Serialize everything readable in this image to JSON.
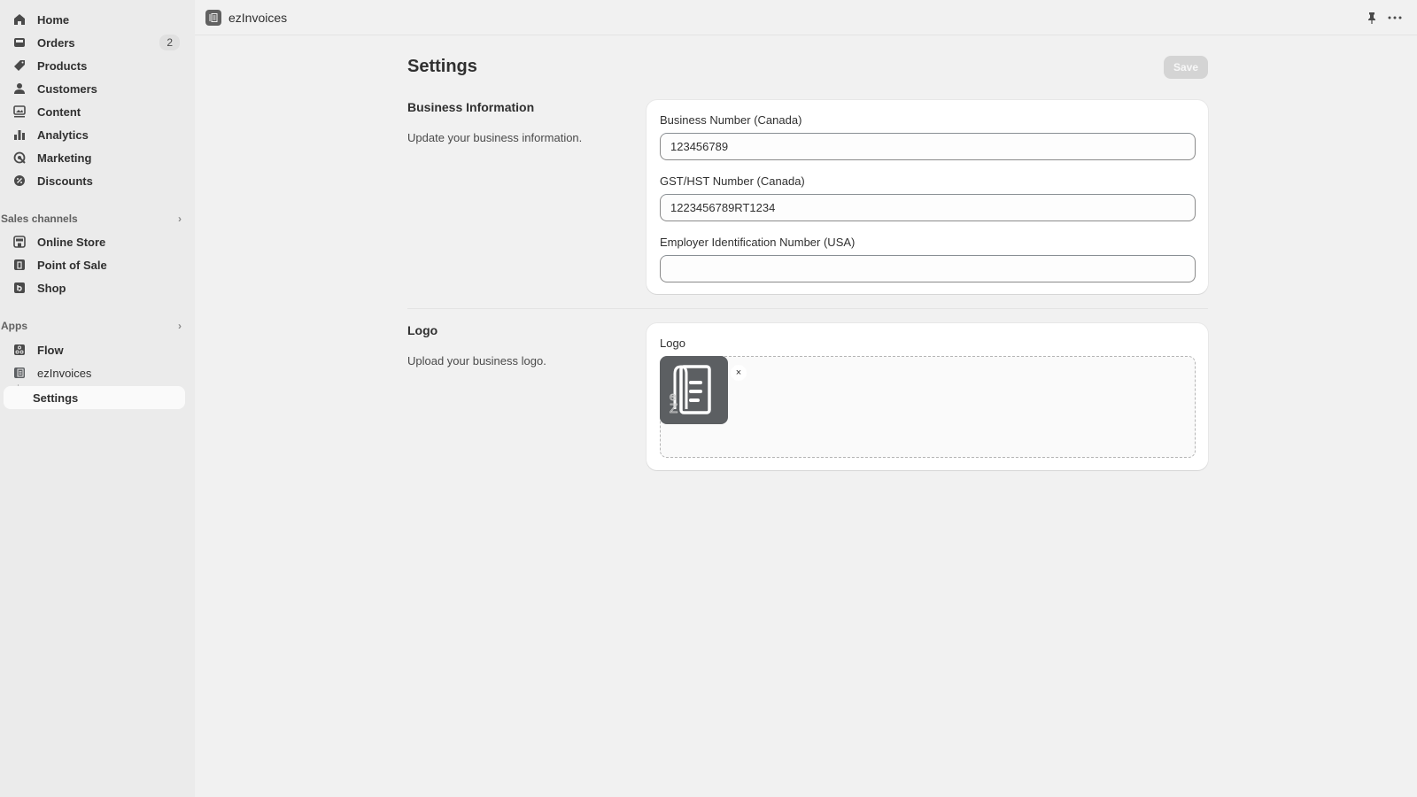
{
  "sidebar": {
    "main_items": [
      {
        "label": "Home",
        "icon": "home-icon"
      },
      {
        "label": "Orders",
        "icon": "orders-icon",
        "badge": "2"
      },
      {
        "label": "Products",
        "icon": "tag-icon"
      },
      {
        "label": "Customers",
        "icon": "person-icon"
      },
      {
        "label": "Content",
        "icon": "content-icon"
      },
      {
        "label": "Analytics",
        "icon": "bar-chart-icon"
      },
      {
        "label": "Marketing",
        "icon": "target-icon"
      },
      {
        "label": "Discounts",
        "icon": "discount-icon"
      }
    ],
    "sales_channels": {
      "title": "Sales channels",
      "items": [
        {
          "label": "Online Store",
          "icon": "store-icon"
        },
        {
          "label": "Point of Sale",
          "icon": "pos-icon"
        },
        {
          "label": "Shop",
          "icon": "shop-icon"
        }
      ]
    },
    "apps": {
      "title": "Apps",
      "items": [
        {
          "label": "Flow",
          "icon": "flow-icon"
        },
        {
          "label": "ezInvoices",
          "icon": "invoice-icon"
        }
      ],
      "sub_item": {
        "label": "Settings"
      }
    }
  },
  "topbar": {
    "app_name": "ezInvoices",
    "pin_icon": "pin-icon",
    "more_icon": "more-horizontal-icon"
  },
  "page": {
    "title": "Settings",
    "save_label": "Save"
  },
  "business_info": {
    "title": "Business Information",
    "description": "Update your business information.",
    "fields": [
      {
        "label": "Business Number (Canada)",
        "value": "123456789"
      },
      {
        "label": "GST/HST Number (Canada)",
        "value": "1223456789RT1234"
      },
      {
        "label": "Employer Identification Number (USA)",
        "value": ""
      }
    ]
  },
  "logo_section": {
    "title": "Logo",
    "description": "Upload your business logo.",
    "field_label": "Logo",
    "remove_label": "×",
    "logo_text": "eZ"
  },
  "colors": {
    "sidebar_bg": "#ebebeb",
    "main_bg": "#f1f1f1",
    "card_bg": "#ffffff",
    "save_disabled": "#d4d4d4",
    "logo_bg": "#5c5f62"
  }
}
